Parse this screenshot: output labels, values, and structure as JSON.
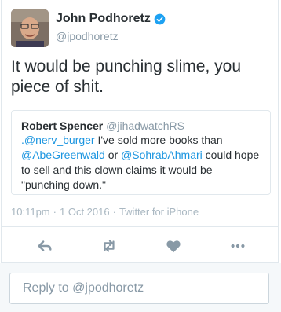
{
  "author": {
    "name": "John Podhoretz",
    "handle": "@jpodhoretz",
    "verified_icon": "verified-badge-icon"
  },
  "tweet": {
    "text": "It would be punching slime, you piece of shit."
  },
  "quoted": {
    "name": "Robert Spencer",
    "handle": "@jihadwatchRS",
    "segments": [
      {
        "text": ".@nerv_burger",
        "type": "mention"
      },
      {
        "text": " I've sold more books than ",
        "type": "text"
      },
      {
        "text": "@AbeGreenwald",
        "type": "mention"
      },
      {
        "text": " or ",
        "type": "text"
      },
      {
        "text": "@SohrabAhmari",
        "type": "mention"
      },
      {
        "text": " could hope to sell and this clown claims it would be \"punching down.\"",
        "type": "text"
      }
    ]
  },
  "meta": {
    "time": "10:11pm",
    "separator1": "·",
    "date": "1 Oct 2016",
    "separator2": "·",
    "source": "Twitter for iPhone"
  },
  "actions": {
    "icons": [
      "reply-icon",
      "retweet-icon",
      "like-icon",
      "more-icon"
    ]
  },
  "reply_box": {
    "placeholder": "Reply to @jpodhoretz"
  },
  "colors": {
    "link": "#1b95e0",
    "muted": "#8899a6",
    "border": "#e1e8ed",
    "verified": "#1da1f2"
  }
}
